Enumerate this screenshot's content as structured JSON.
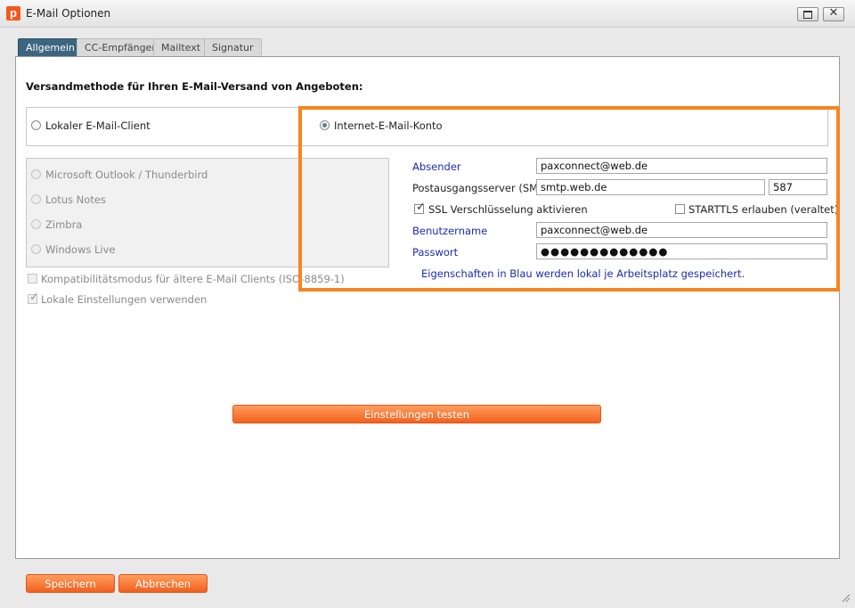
{
  "window": {
    "title": "E-Mail Optionen",
    "app_icon_letter": "p"
  },
  "tabs": [
    {
      "label": "Allgemein",
      "active": true
    },
    {
      "label": "CC-Empfänger",
      "active": false
    },
    {
      "label": "Mailtext",
      "active": false
    },
    {
      "label": "Signatur",
      "active": false
    }
  ],
  "section_heading": "Versandmethode für Ihren E-Mail-Versand von Angeboten:",
  "methods": {
    "local": {
      "label": "Lokaler E-Mail-Client",
      "selected": false
    },
    "internet": {
      "label": "Internet-E-Mail-Konto",
      "selected": true
    }
  },
  "local_clients": [
    "Microsoft Outlook / Thunderbird",
    "Lotus Notes",
    "Zimbra",
    "Windows Live"
  ],
  "compat_mode": {
    "label": "Kompatibilitätsmodus für ältere E-Mail Clients (ISO-8859-1)",
    "checked": false
  },
  "local_settings": {
    "label": "Lokale Einstellungen verwenden",
    "checked": true
  },
  "account": {
    "sender_label": "Absender",
    "sender_value": "paxconnect@web.de",
    "smtp_label": "Postausgangsserver (SMTP)",
    "smtp_value": "smtp.web.de",
    "port_value": "587",
    "ssl_label": "SSL Verschlüsselung aktivieren",
    "ssl_checked": true,
    "starttls_label": "STARTTLS erlauben (veraltet)",
    "starttls_checked": false,
    "username_label": "Benutzername",
    "username_value": "paxconnect@web.de",
    "password_label": "Passwort",
    "password_value": "●●●●●●●●●●●●●",
    "note": "Eigenschaften in Blau werden lokal je Arbeitsplatz gespeichert."
  },
  "buttons": {
    "test": "Einstellungen testen",
    "save": "Speichern",
    "cancel": "Abbrechen"
  },
  "colors": {
    "accent_orange": "#f7851e",
    "active_tab": "#3d6580",
    "blue_label": "#1a2cb0"
  }
}
